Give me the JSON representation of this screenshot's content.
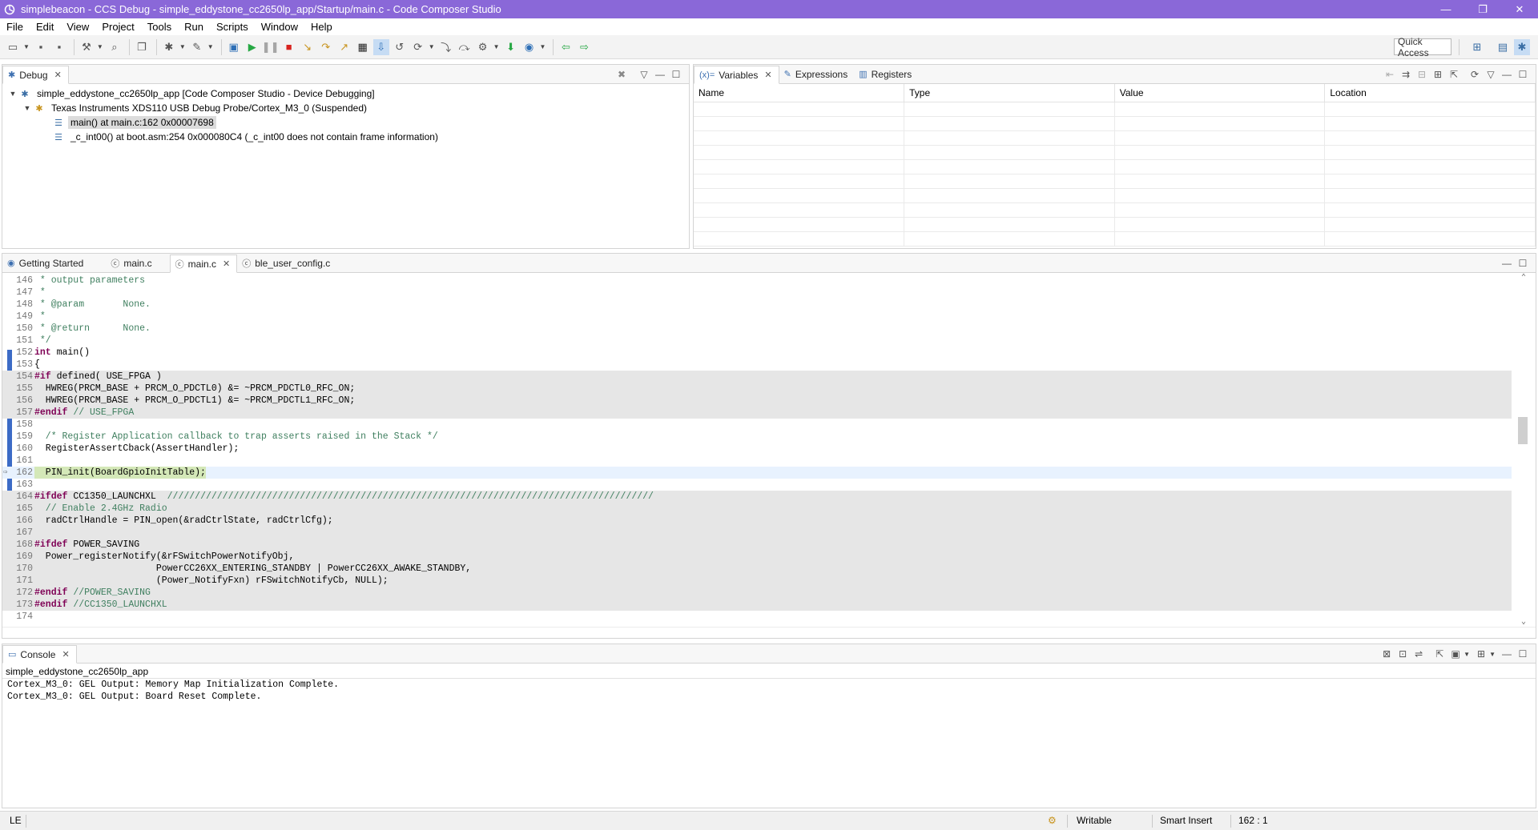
{
  "window": {
    "title": "simplebeacon - CCS Debug - simple_eddystone_cc2650lp_app/Startup/main.c - Code Composer Studio",
    "controls": [
      "—",
      "❐",
      "✕"
    ]
  },
  "menu": [
    "File",
    "Edit",
    "View",
    "Project",
    "Tools",
    "Run",
    "Scripts",
    "Window",
    "Help"
  ],
  "toolbar": {
    "quick_access": "Quick Access"
  },
  "debug_view": {
    "tab_label": "Debug",
    "tree": [
      {
        "label": "simple_eddystone_cc2650lp_app [Code Composer Studio - Device Debugging]",
        "icon": "debug-session-icon"
      },
      {
        "label": "Texas Instruments XDS110 USB Debug Probe/Cortex_M3_0 (Suspended)",
        "icon": "debug-target-icon"
      },
      {
        "label": "main() at main.c:162 0x00007698",
        "icon": "stack-frame-icon",
        "selected": true
      },
      {
        "label": "_c_int00() at boot.asm:254 0x000080C4  (_c_int00 does not contain frame information)",
        "icon": "stack-frame-icon"
      }
    ]
  },
  "variables_view": {
    "tabs": [
      "Variables",
      "Expressions",
      "Registers"
    ],
    "columns": [
      "Name",
      "Type",
      "Value",
      "Location"
    ]
  },
  "editor": {
    "tabs": [
      "Getting Started",
      "main.c",
      "main.c",
      "ble_user_config.c"
    ],
    "active_tab": 2,
    "lines": [
      {
        "n": "146",
        "text": " * output parameters",
        "cls": "cm"
      },
      {
        "n": "147",
        "text": " *",
        "cls": "cm"
      },
      {
        "n": "148",
        "text": " * @param       None.",
        "cls": "cm"
      },
      {
        "n": "149",
        "text": " *",
        "cls": "cm"
      },
      {
        "n": "150",
        "text": " * @return      None.",
        "cls": "cm"
      },
      {
        "n": "151",
        "text": " */",
        "cls": "cm"
      },
      {
        "n": "152",
        "kw": "int",
        "text": " main()"
      },
      {
        "n": "153",
        "text": "{"
      },
      {
        "n": "154",
        "kw": "#if",
        "text": " defined( USE_FPGA )",
        "inactive": true
      },
      {
        "n": "155",
        "text": "  HWREG(PRCM_BASE + PRCM_O_PDCTL0) &= ~PRCM_PDCTL0_RFC_ON;",
        "inactive": true
      },
      {
        "n": "156",
        "text": "  HWREG(PRCM_BASE + PRCM_O_PDCTL1) &= ~PRCM_PDCTL1_RFC_ON;",
        "inactive": true
      },
      {
        "n": "157",
        "kw": "#endif",
        "comment": " // USE_FPGA",
        "inactive": true
      },
      {
        "n": "158",
        "text": ""
      },
      {
        "n": "159",
        "text": "  /* Register Application callback to trap asserts raised in the Stack */",
        "cls": "cm"
      },
      {
        "n": "160",
        "text": "  RegisterAssertCback(AssertHandler);"
      },
      {
        "n": "161",
        "text": ""
      },
      {
        "n": "162",
        "text": "  PIN_init(BoardGpioInitTable);",
        "current": true
      },
      {
        "n": "163",
        "text": ""
      },
      {
        "n": "164",
        "kw": "#ifdef",
        "text": " CC1350_LAUNCHXL  ",
        "comment": "////////////////////////////////////////////////////////////////////////////////////////",
        "inactive": true
      },
      {
        "n": "165",
        "text": "  // Enable 2.4GHz Radio",
        "cls": "cm",
        "inactive": true
      },
      {
        "n": "166",
        "text": "  radCtrlHandle = PIN_open(&radCtrlState, radCtrlCfg);",
        "inactive": true
      },
      {
        "n": "167",
        "text": "",
        "inactive": true
      },
      {
        "n": "168",
        "kw": "#ifdef",
        "text": " POWER_SAVING",
        "inactive": true
      },
      {
        "n": "169",
        "text": "  Power_registerNotify(&rFSwitchPowerNotifyObj,",
        "inactive": true
      },
      {
        "n": "170",
        "text": "                      PowerCC26XX_ENTERING_STANDBY | PowerCC26XX_AWAKE_STANDBY,",
        "inactive": true
      },
      {
        "n": "171",
        "text": "                      (Power_NotifyFxn) rFSwitchNotifyCb, NULL);",
        "inactive": true
      },
      {
        "n": "172",
        "kw": "#endif",
        "comment": " //POWER_SAVING",
        "inactive": true
      },
      {
        "n": "173",
        "kw": "#endif",
        "comment": " //CC1350_LAUNCHXL",
        "inactive": true
      },
      {
        "n": "174",
        "text": ""
      }
    ]
  },
  "console": {
    "tab_label": "Console",
    "session_label": "simple_eddystone_cc2650lp_app",
    "lines": [
      "Cortex_M3_0: GEL Output: Memory Map Initialization Complete.",
      "Cortex_M3_0: GEL Output: Board Reset Complete."
    ]
  },
  "status": {
    "left": "LE",
    "writable": "Writable",
    "insert_mode": "Smart Insert",
    "position": "162 : 1"
  }
}
